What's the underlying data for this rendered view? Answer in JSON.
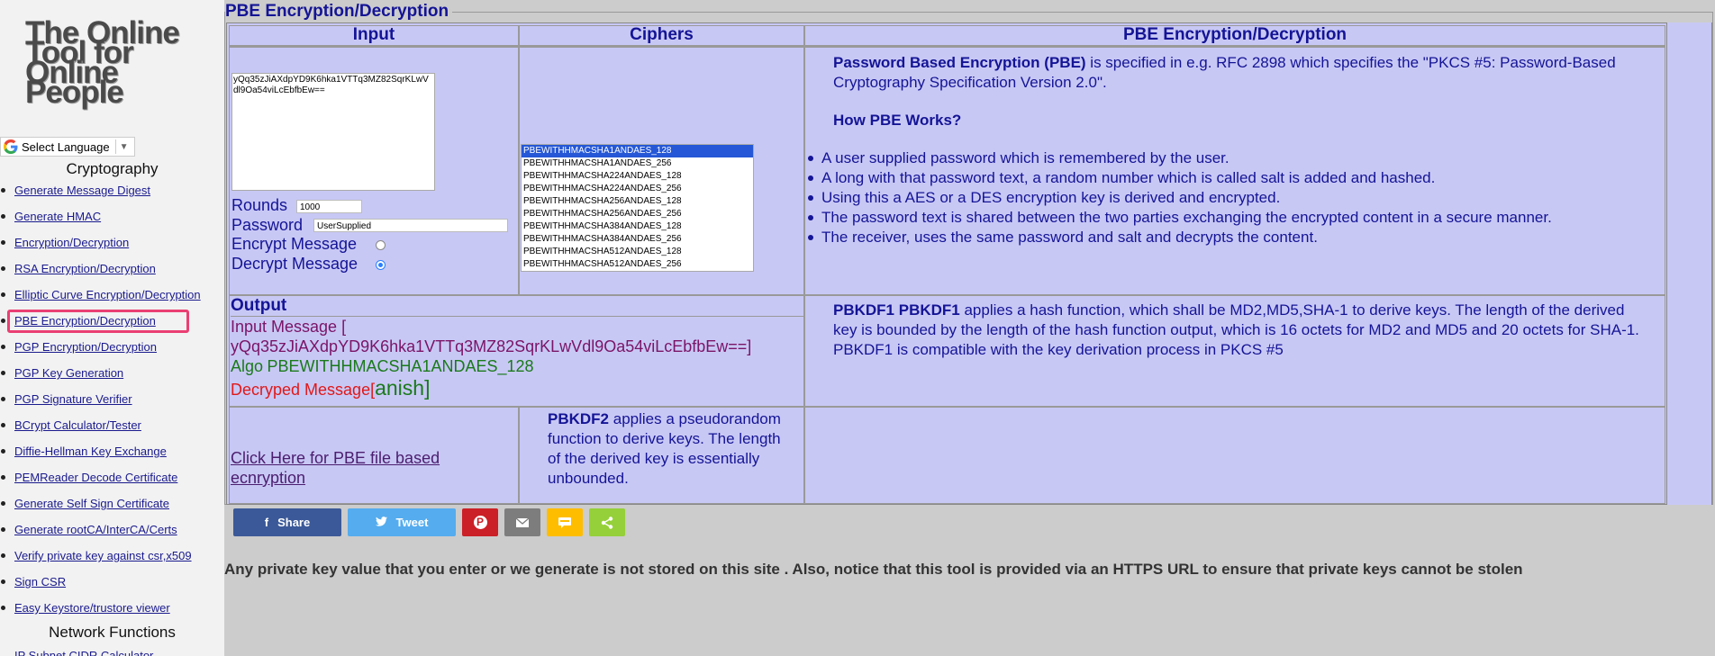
{
  "sidebar": {
    "logo_lines": [
      "The Online",
      "Tool for",
      "Online",
      "People"
    ],
    "language_label": "Select Language",
    "section_crypto": "Cryptography",
    "items": [
      "Generate Message Digest",
      "Generate HMAC",
      "Encryption/Decryption",
      "RSA Encryption/Decryption",
      "Elliptic Curve Encryption/Decryption",
      "PBE Encryption/Decryption",
      "PGP Encryption/Decryption",
      "PGP Key Generation",
      "PGP Signature Verifier",
      "BCrypt Calculator/Tester",
      "Diffie-Hellman Key Exchange",
      "PEMReader Decode Certificate",
      "Generate Self Sign Certificate",
      "Generate rootCA/InterCA/Certs",
      "Verify private key against csr,x509",
      "Sign CSR",
      "Easy Keystore/trustore viewer"
    ],
    "active_item": "PBE Encryption/Decryption",
    "section_network": "Network Functions",
    "network_first_item": "IP Subnet CIDR Calculator"
  },
  "page": {
    "legend": "PBE Encryption/Decryption",
    "headers": {
      "input": "Input",
      "ciphers": "Ciphers",
      "info": "PBE Encryption/Decryption"
    }
  },
  "input": {
    "ciphertext": "yQq35zJiAXdpYD9K6hka1VTTq3MZ82SqrKLwVdl9Oa54viLcEbfbEw==",
    "rounds_label": "Rounds",
    "rounds_value": "1000",
    "password_label": "Password",
    "password_value": "UserSupplied",
    "encrypt_label": "Encrypt Message",
    "decrypt_label": "Decrypt Message",
    "mode_selected": "decrypt"
  },
  "ciphers": {
    "options": [
      "PBEWITHHMACSHA1ANDAES_128",
      "PBEWITHHMACSHA1ANDAES_256",
      "PBEWITHHMACSHA224ANDAES_128",
      "PBEWITHHMACSHA224ANDAES_256",
      "PBEWITHHMACSHA256ANDAES_128",
      "PBEWITHHMACSHA256ANDAES_256",
      "PBEWITHHMACSHA384ANDAES_128",
      "PBEWITHHMACSHA384ANDAES_256",
      "PBEWITHHMACSHA512ANDAES_128",
      "PBEWITHHMACSHA512ANDAES_256"
    ],
    "selected": "PBEWITHHMACSHA1ANDAES_128"
  },
  "info": {
    "pbe_bold": "Password Based Encryption (PBE)",
    "pbe_text": " is specified in e.g. RFC 2898 which specifies the \"PKCS #5: Password-Based Cryptography Specification Version 2.0\".",
    "how_title": "How PBE Works?",
    "bullets": [
      "A user supplied password which is remembered by the user.",
      "A long with that password text, a random number which is called salt is added and hashed.",
      "Using this a AES or a DES encryption key is derived and encrypted.",
      "The password text is shared between the two parties exchanging the encrypted content in a secure manner.",
      "The receiver, uses the same password and salt and decrypts the content."
    ],
    "pbkdf1_bold": "PBKDF1 PBKDF1",
    "pbkdf1_text": " applies a hash function, which shall be MD2,MD5,SHA-1 to derive keys. The length of the derived key is bounded by the length of the hash function output, which is 16 octets for MD2 and MD5 and 20 octets for SHA-1. PBKDF1 is compatible with the key derivation process in PKCS #5",
    "pbkdf2_bold": "PBKDF2",
    "pbkdf2_text": " applies a pseudorandom function to derive keys. The length of the derived key is essentially unbounded."
  },
  "output": {
    "title": "Output",
    "input_message_label": "Input Message [",
    "input_message_value": "yQq35zJiAXdpYD9K6hka1VTTq3MZ82SqrKLwVdl9Oa54viLcEbfbEw==]",
    "algo_label": "Algo",
    "algo_value": "PBEWITHHMACSHA1ANDAES_128",
    "decrypted_label": "Decryped Message[",
    "decrypted_value": "anish",
    "decrypted_close": "]",
    "file_link": "Click Here for PBE file based ecnryption"
  },
  "share": {
    "facebook": "Share",
    "twitter": "Tweet",
    "colors": {
      "facebook": "#3b5998",
      "twitter": "#55acee",
      "pinterest": "#cb2027",
      "email": "#7d7d7d",
      "sms": "#ffbd00",
      "sharethis": "#95d03a"
    }
  },
  "disclaimer": "Any private key value that you enter or we generate is not stored on this site . Also, notice that this tool is provided via an HTTPS URL to ensure that private keys cannot be stolen"
}
